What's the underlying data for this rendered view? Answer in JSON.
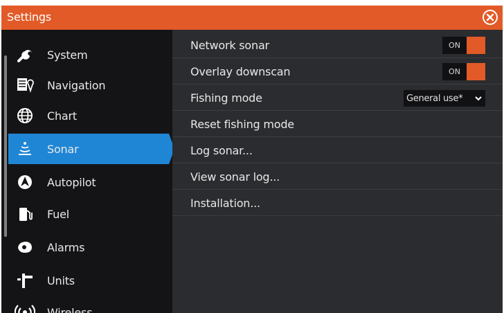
{
  "window": {
    "title": "Settings",
    "accent_color": "#e25a27",
    "selection_color": "#1f86d6",
    "close_icon": "close-circle-icon"
  },
  "sidebar": {
    "items": [
      {
        "label": "System",
        "icon": "wrench-icon",
        "selected": false
      },
      {
        "label": "Navigation",
        "icon": "navigation-route-icon",
        "selected": false
      },
      {
        "label": "Chart",
        "icon": "globe-icon",
        "selected": false
      },
      {
        "label": "Sonar",
        "icon": "sonar-icon",
        "selected": true
      },
      {
        "label": "Autopilot",
        "icon": "autopilot-icon",
        "selected": false
      },
      {
        "label": "Fuel",
        "icon": "fuel-pump-icon",
        "selected": false
      },
      {
        "label": "Alarms",
        "icon": "alarm-icon",
        "selected": false
      },
      {
        "label": "Units",
        "icon": "units-icon",
        "selected": false
      },
      {
        "label": "Wireless",
        "icon": "wireless-icon",
        "selected": false
      }
    ]
  },
  "sonar_settings": {
    "network_sonar": {
      "label": "Network sonar",
      "state": "ON"
    },
    "overlay_downscan": {
      "label": "Overlay downscan",
      "state": "ON"
    },
    "fishing_mode": {
      "label": "Fishing mode",
      "value": "General use*"
    },
    "reset_fishing_mode": {
      "label": "Reset fishing mode"
    },
    "log_sonar": {
      "label": "Log sonar..."
    },
    "view_sonar_log": {
      "label": "View sonar log..."
    },
    "installation": {
      "label": "Installation..."
    }
  }
}
